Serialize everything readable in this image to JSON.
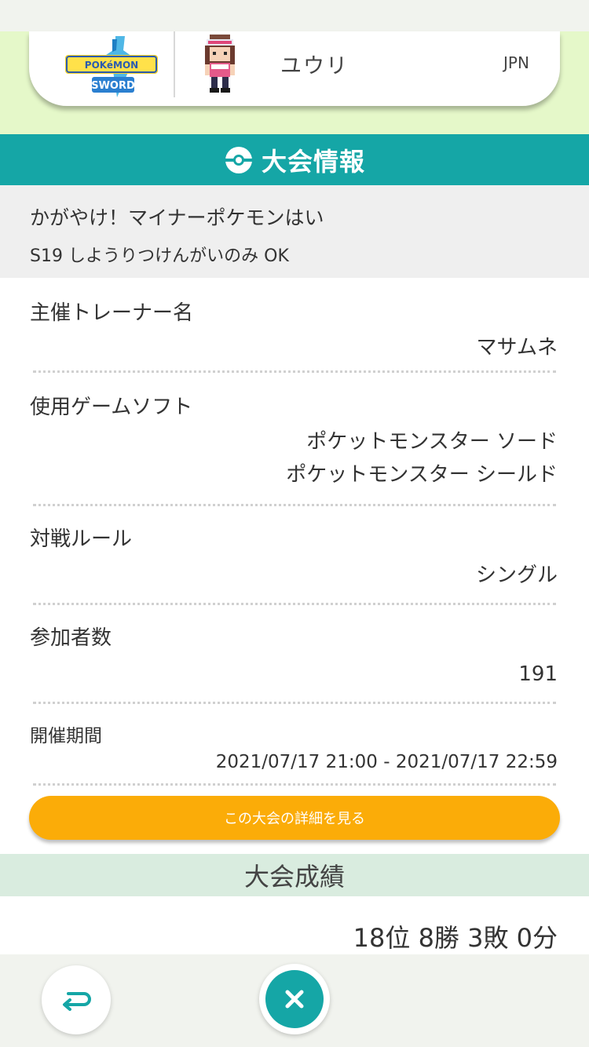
{
  "player": {
    "name": "ユウリ",
    "region": "JPN",
    "game_logo_text": "ポケットモンスター ソード"
  },
  "section": {
    "title": "大会情報"
  },
  "tournament": {
    "name_line1": "かがやけ！マイナーポケモンはい",
    "name_line2": "S19 しようりつけんがいのみ OK"
  },
  "info": {
    "organizer_label": "主催トレーナー名",
    "organizer_value": "マサムネ",
    "software_label": "使用ゲームソフト",
    "software_value_1": "ポケットモンスター ソード",
    "software_value_2": "ポケットモンスター シールド",
    "rule_label": "対戦ルール",
    "rule_value": "シングル",
    "participants_label": "参加者数",
    "participants_value": "191",
    "period_label": "開催期間",
    "period_value": "2021/07/17 21:00 - 2021/07/17 22:59"
  },
  "detail_button_label": "この大会の詳細を見る",
  "results": {
    "title": "大会成績",
    "value": "18位 8勝 3敗 0分"
  },
  "colors": {
    "teal": "#15a6a6",
    "orange": "#fbac08",
    "header_green": "#e5f8c9"
  },
  "icons": {
    "back": "return-arrow-icon",
    "close": "close-icon",
    "section": "pokeball-icon"
  }
}
